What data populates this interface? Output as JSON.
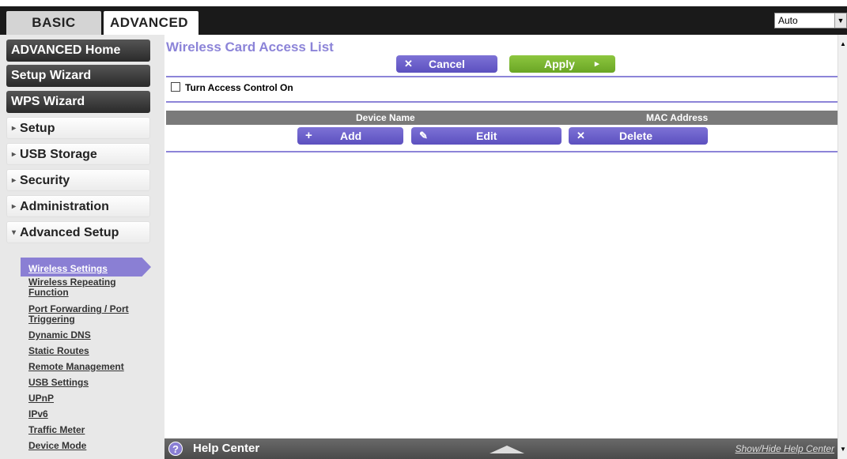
{
  "tabs": {
    "basic": "BASIC",
    "advanced": "ADVANCED"
  },
  "language": {
    "selected": "Auto",
    "arrow": "▼"
  },
  "sidebar": {
    "advanced_home": "ADVANCED Home",
    "setup_wizard": "Setup Wizard",
    "wps_wizard": "WPS Wizard",
    "setup": "Setup",
    "usb_storage": "USB Storage",
    "security": "Security",
    "administration": "Administration",
    "advanced_setup": "Advanced Setup",
    "collapsed_icon": "▸",
    "expanded_icon": "▾"
  },
  "submenu": {
    "wireless_settings": "Wireless Settings",
    "wireless_repeating_1": "Wireless Repeating",
    "wireless_repeating_2": "Function",
    "port_forwarding_1": "Port Forwarding / Port",
    "port_forwarding_2": "Triggering",
    "dynamic_dns": "Dynamic DNS",
    "static_routes": "Static Routes",
    "remote_management": "Remote Management",
    "usb_settings": "USB Settings",
    "upnp": "UPnP",
    "ipv6": "IPv6",
    "traffic_meter": "Traffic Meter",
    "device_mode": "Device Mode"
  },
  "main": {
    "title": "Wireless Card Access List",
    "cancel": "Cancel",
    "apply": "Apply",
    "access_control": "Turn Access Control On",
    "col_device_name": "Device Name",
    "col_mac_address": "MAC Address",
    "add": "Add",
    "edit": "Edit",
    "delete": "Delete",
    "icons": {
      "cancel": "✕",
      "apply": "▸",
      "add": "+",
      "edit": "✎",
      "delete": "✕"
    }
  },
  "help": {
    "icon": "?",
    "label": "Help Center",
    "toggle": "Show/Hide Help Center"
  },
  "colors": {
    "accent": "#8c84d8",
    "apply_green": "#7ab832",
    "dark_bar": "#1a1a1a"
  }
}
